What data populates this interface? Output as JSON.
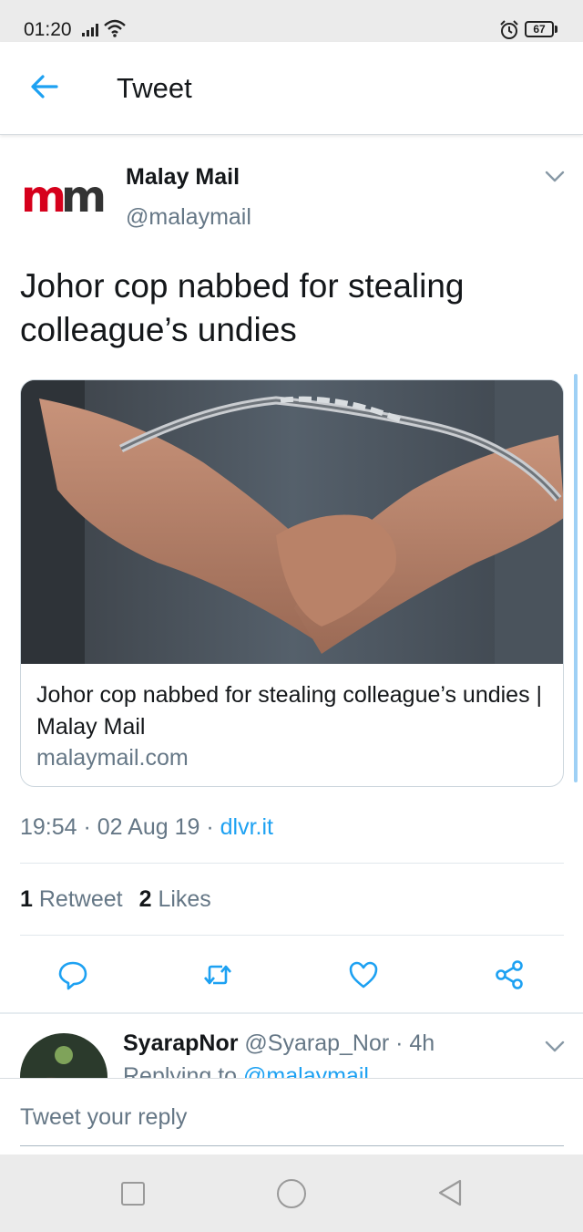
{
  "status_bar": {
    "time": "01:20",
    "battery": "67"
  },
  "header": {
    "title": "Tweet"
  },
  "tweet": {
    "author_name": "Malay Mail",
    "author_handle": "@malaymail",
    "text": "Johor cop nabbed for stealing colleague’s undies",
    "card": {
      "title": "Johor cop nabbed for stealing colleague’s undies | Malay Mail",
      "domain": "malaymail.com"
    },
    "time": "19:54",
    "date": "02 Aug 19",
    "source": "dlvr.it",
    "retweets_count": "1",
    "retweets_label": "Retweet",
    "likes_count": "2",
    "likes_label": "Likes"
  },
  "reply": {
    "name": "SyarapNor",
    "handle": "@Syarap_Nor",
    "age": "4h",
    "replying_prefix": "Replying to",
    "replying_to": "@malaymail"
  },
  "compose": {
    "placeholder": "Tweet your reply"
  },
  "colors": {
    "accent": "#1da1f2",
    "secondary_text": "#657786",
    "logo_red": "#d6001c"
  },
  "icons": [
    "signal-icon",
    "wifi-icon",
    "alarm-icon",
    "battery-icon",
    "back-arrow-icon",
    "chevron-down-icon",
    "reply-icon",
    "retweet-icon",
    "like-icon",
    "share-icon",
    "nav-recents-icon",
    "nav-home-icon",
    "nav-back-icon"
  ]
}
